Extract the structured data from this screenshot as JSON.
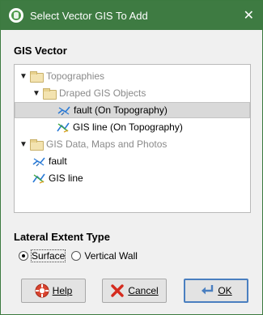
{
  "window": {
    "title": "Select Vector GIS To Add",
    "close_glyph": "✕",
    "app_icon": "app-logo-icon"
  },
  "gis_vector": {
    "heading": "GIS Vector",
    "tree": [
      {
        "label": "Topographies",
        "depth": 0,
        "expanded": true,
        "kind": "folder",
        "muted": true
      },
      {
        "label": "Draped GIS Objects",
        "depth": 1,
        "expanded": true,
        "kind": "folder",
        "muted": true
      },
      {
        "label": "fault (On Topography)",
        "depth": 2,
        "kind": "gis-fault",
        "selected": true
      },
      {
        "label": "GIS line (On Topography)",
        "depth": 2,
        "kind": "gis-line"
      },
      {
        "label": "GIS Data, Maps and Photos",
        "depth": 0,
        "expanded": true,
        "kind": "folder",
        "muted": true
      },
      {
        "label": "fault",
        "depth": 1,
        "kind": "gis-fault"
      },
      {
        "label": "GIS line",
        "depth": 1,
        "kind": "gis-line"
      }
    ]
  },
  "lateral_extent": {
    "heading": "Lateral Extent Type",
    "options": [
      {
        "label": "Surface",
        "checked": true
      },
      {
        "label": "Vertical Wall",
        "checked": false
      }
    ]
  },
  "buttons": {
    "help": "Help",
    "cancel": "Cancel",
    "ok": "OK"
  },
  "colors": {
    "titlebar": "#3e7b42",
    "selection": "#d9d9d9",
    "muted_text": "#8a8a8a",
    "default_button_border": "#4a7fc0"
  }
}
